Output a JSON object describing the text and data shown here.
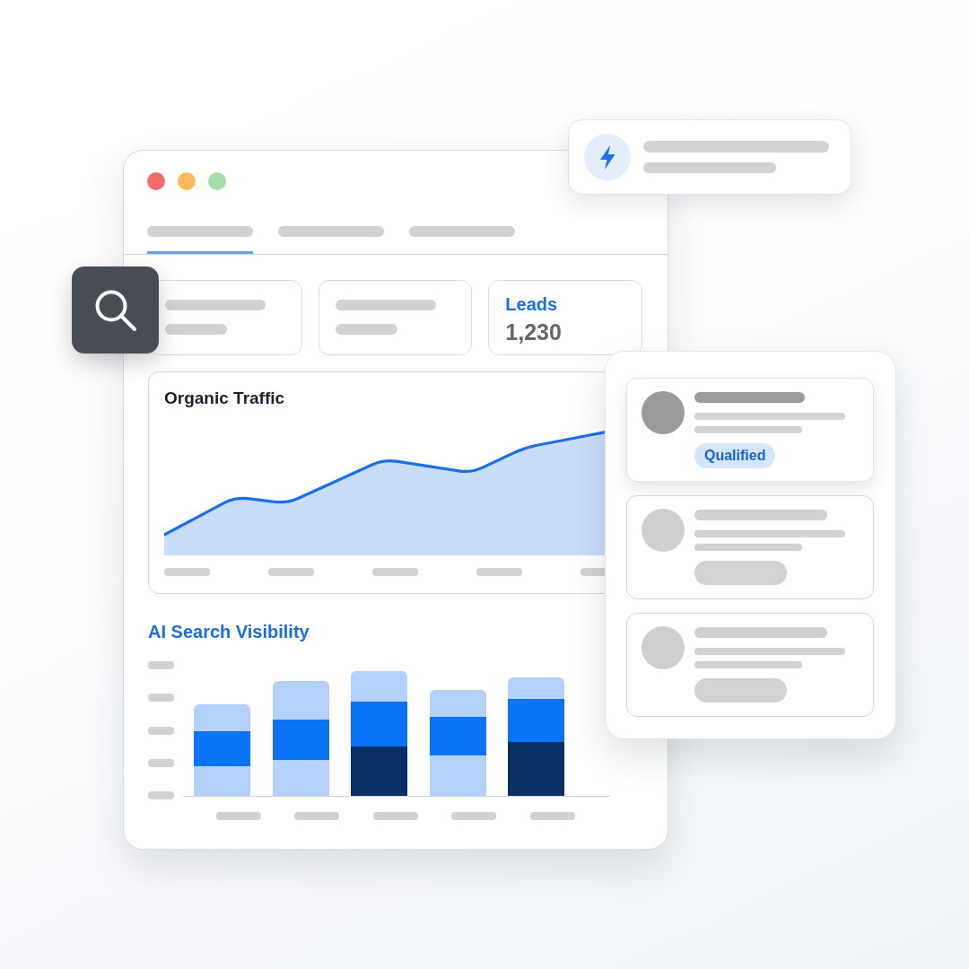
{
  "window": {
    "tabs": [
      {
        "selected": true
      },
      {
        "selected": false
      },
      {
        "selected": false
      }
    ],
    "stat_cards": [
      {
        "kind": "placeholder"
      },
      {
        "kind": "placeholder"
      },
      {
        "kind": "metric",
        "label": "Leads",
        "value": "1,230"
      }
    ],
    "traffic_chart": {
      "title": "Organic Traffic"
    },
    "visibility_chart": {
      "title": "AI Search Visibility"
    }
  },
  "leads_panel": {
    "cards": [
      {
        "selected": true,
        "badge": "Qualified"
      },
      {
        "selected": false
      },
      {
        "selected": false
      }
    ]
  }
}
